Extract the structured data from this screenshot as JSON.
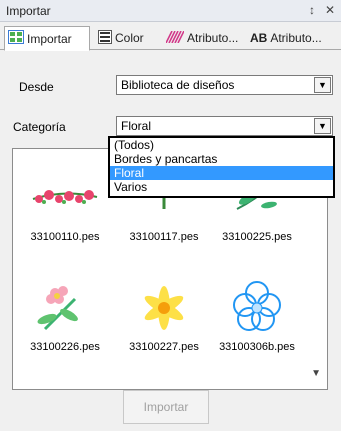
{
  "window": {
    "title": "Importar",
    "pin_glyph": "↕",
    "close_glyph": "✕"
  },
  "tabs": [
    {
      "label": "Importar",
      "icon": "import-icon"
    },
    {
      "label": "Color",
      "icon": "color-list-icon"
    },
    {
      "label": "Atributo...",
      "icon": "stitch-attribute-icon"
    },
    {
      "label": "Atributo...",
      "prefix": "AB",
      "icon": "text-attribute-icon"
    }
  ],
  "source": {
    "label": "Desde",
    "value": "Biblioteca de diseños"
  },
  "category": {
    "label": "Categoría",
    "value": "Floral",
    "options": [
      "(Todos)",
      "Bordes y pancartas",
      "Floral",
      "Varios"
    ],
    "selected_index": 2
  },
  "thumbnails": [
    {
      "file": "33100110.pes",
      "icon": "flower-border-design-icon"
    },
    {
      "file": "33100117.pes",
      "icon": "sunflower-design-icon"
    },
    {
      "file": "33100225.pes",
      "icon": "leaf-spray-design-icon"
    },
    {
      "file": "33100226.pes",
      "icon": "pink-flower-design-icon"
    },
    {
      "file": "33100227.pes",
      "icon": "yellow-flower-design-icon"
    },
    {
      "file": "33100306b.pes",
      "icon": "blue-flower-outline-icon"
    }
  ],
  "import_button": {
    "label": "Importar"
  },
  "colors": {
    "selection": "#3399ff",
    "tab_border": "#a8a8a8"
  }
}
